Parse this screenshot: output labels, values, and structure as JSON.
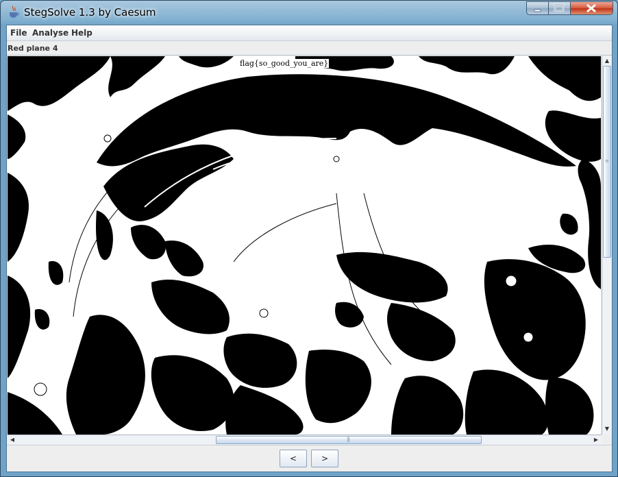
{
  "window": {
    "title": "StegSolve 1.3 by Caesum"
  },
  "menu": {
    "file": "File",
    "analyse": "Analyse",
    "help": "Help"
  },
  "view": {
    "plane_label": "Red plane 4",
    "hidden_text": "flag{so_good_you_are}"
  },
  "nav": {
    "prev": "<",
    "next": ">"
  },
  "scrollbars": {
    "horizontal_position": 0.5,
    "vertical_position": 0.0
  }
}
